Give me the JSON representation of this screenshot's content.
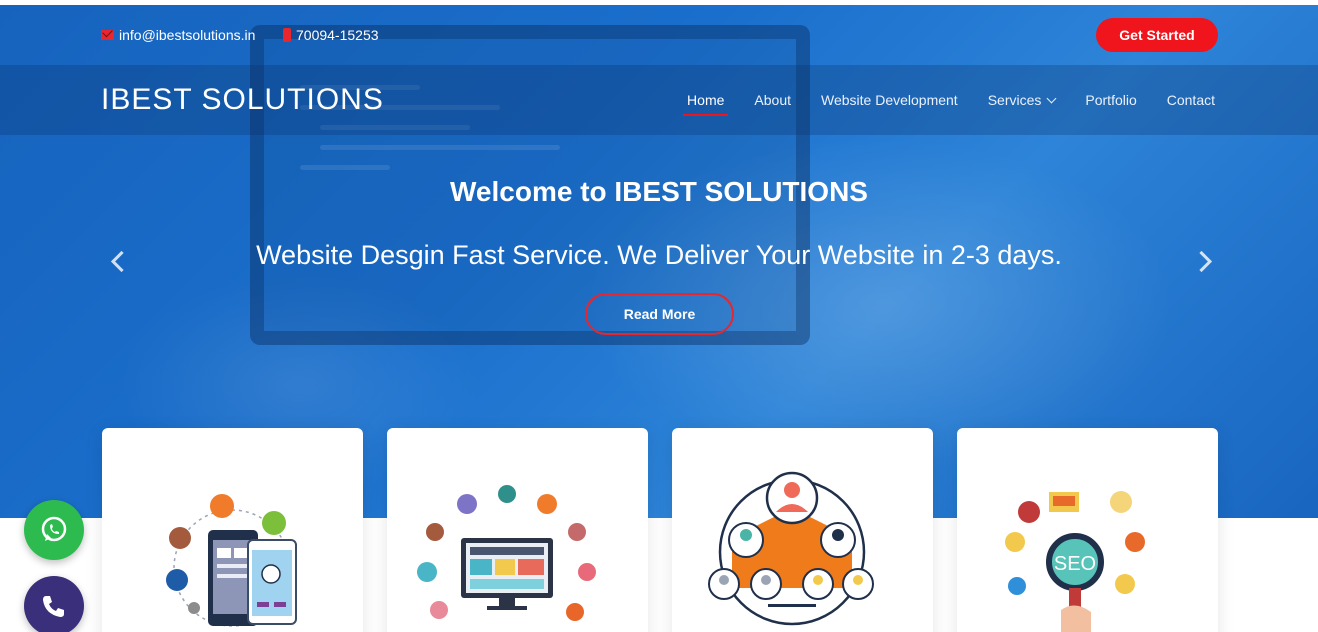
{
  "topbar": {
    "email": "info@ibestsolutions.in",
    "phone": "70094-15253",
    "cta_label": "Get Started"
  },
  "navbar": {
    "logo": "IBEST SOLUTIONS",
    "items": [
      {
        "label": "Home",
        "active": true
      },
      {
        "label": "About"
      },
      {
        "label": "Website Development"
      },
      {
        "label": "Services",
        "has_dropdown": true
      },
      {
        "label": "Portfolio"
      },
      {
        "label": "Contact"
      }
    ]
  },
  "hero": {
    "title": "Welcome to IBEST SOLUTIONS",
    "subtitle": "Website Desgin Fast Service. We Deliver Your Website in 2-3 days.",
    "button_label": "Read More"
  },
  "cards": [
    {
      "icon": "mobile-app-illustration-icon"
    },
    {
      "icon": "web-development-illustration-icon"
    },
    {
      "icon": "social-network-illustration-icon"
    },
    {
      "icon": "seo-illustration-icon"
    }
  ],
  "floating": {
    "whatsapp_icon": "whatsapp-icon",
    "call_icon": "phone-icon"
  },
  "colors": {
    "brand_blue": "#1a6fcc",
    "accent_red": "#f0141c",
    "whatsapp_green": "#2dbb4f",
    "call_purple": "#3a2f7a"
  }
}
